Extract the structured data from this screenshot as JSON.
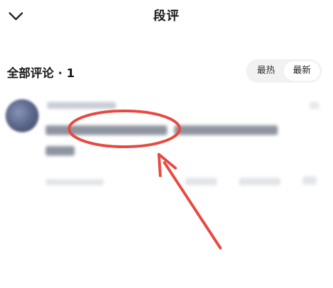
{
  "header": {
    "title": "段评"
  },
  "section": {
    "title": "全部评论 · 1"
  },
  "sort": {
    "hot_label": "最热",
    "new_label": "最新"
  },
  "colors": {
    "annotation": "#e8483f",
    "toggle_bg": "#f2f2f2"
  }
}
